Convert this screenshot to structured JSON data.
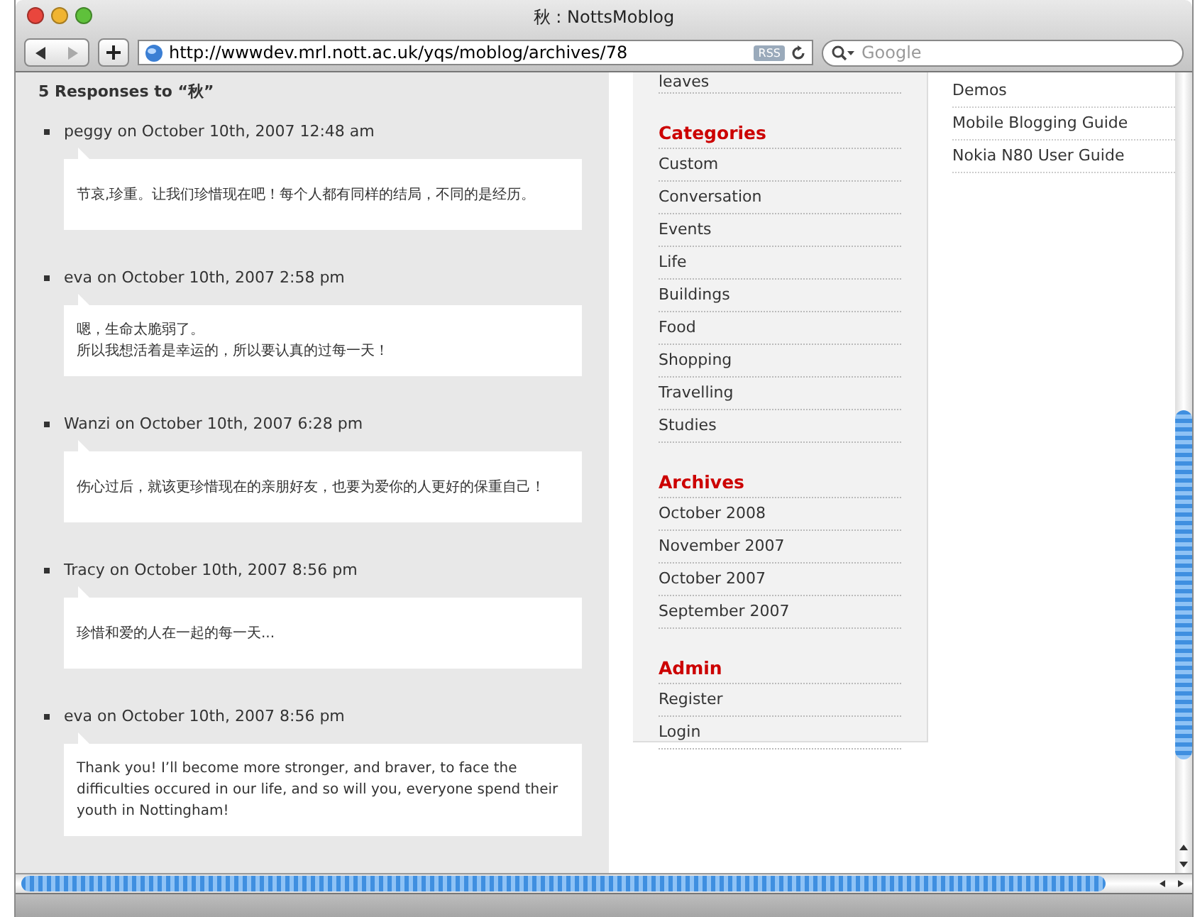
{
  "window": {
    "title": "秋 : NottsMoblog"
  },
  "toolbar": {
    "url": "http://wwwdev.mrl.nott.ac.uk/yqs/moblog/archives/78",
    "rss": "RSS",
    "search_placeholder": "Google"
  },
  "comments_heading": "5 Responses to “秋”",
  "comments": [
    {
      "meta": "peggy on October 10th, 2007 12:48 am",
      "lines": [
        "节哀,珍重。让我们珍惜现在吧！每个人都有同样的结局，不同的是经历。"
      ]
    },
    {
      "meta": "eva on October 10th, 2007 2:58 pm",
      "lines": [
        "嗯，生命太脆弱了。",
        "所以我想活着是幸运的，所以要认真的过每一天！"
      ]
    },
    {
      "meta": "Wanzi on October 10th, 2007 6:28 pm",
      "lines": [
        "伤心过后，就该更珍惜现在的亲朋好友，也要为爱你的人更好的保重自己！"
      ]
    },
    {
      "meta": "Tracy on October 10th, 2007 8:56 pm",
      "lines": [
        "珍惜和爱的人在一起的每一天..."
      ]
    },
    {
      "meta": "eva on October 10th, 2007 8:56 pm",
      "lines": [
        "Thank you! I’ll become more stronger, and braver, to face the difficulties occured in our life, and so will you, everyone spend their youth in Nottingham!"
      ]
    }
  ],
  "sidebar": {
    "cut_item": "leaves",
    "sections": [
      {
        "heading": "Categories",
        "items": [
          "Custom",
          "Conversation",
          "Events",
          "Life",
          "Buildings",
          "Food",
          "Shopping",
          "Travelling",
          "Studies"
        ]
      },
      {
        "heading": "Archives",
        "items": [
          "October 2008",
          "November 2007",
          "October 2007",
          "September 2007"
        ]
      },
      {
        "heading": "Admin",
        "items": [
          "Register",
          "Login"
        ]
      }
    ]
  },
  "links": [
    "Demos",
    "Mobile Blogging Guide",
    "Nokia N80 User Guide"
  ]
}
